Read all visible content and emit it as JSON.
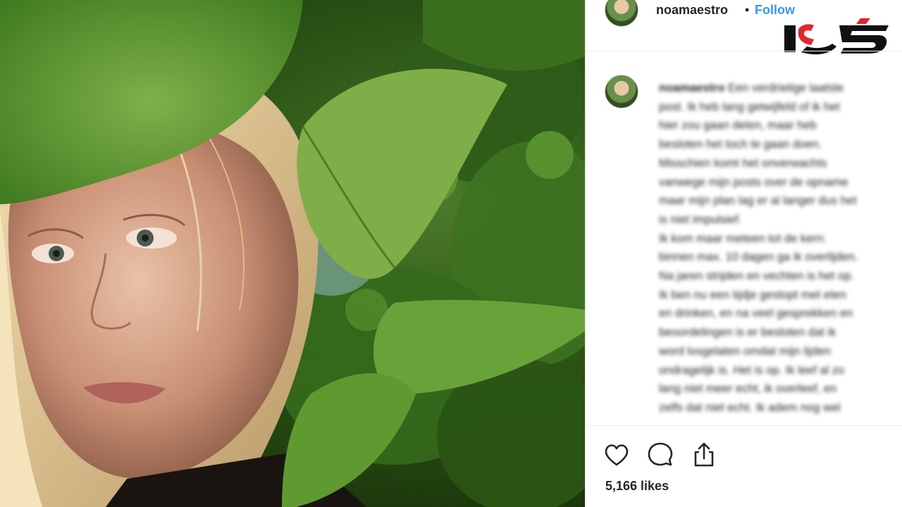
{
  "post": {
    "username": "noamaestro",
    "separator": "•",
    "follow_label": "Follow",
    "caption": {
      "username": "noamaestro",
      "lines": [
        " Een verdrietige laatste",
        "post. Ik heb lang getwijfeld of ik het",
        "hier zou gaan delen, maar heb",
        "besloten het toch te gaan doen.",
        "Misschien komt het onverwachts",
        "vanwege mijn posts over de opname",
        "maar mijn plan lag er al langer dus het",
        "is niet impulsief.",
        "Ik kom maar meteen tot de kern:",
        "binnen max. 10 dagen ga ik overlijden.",
        "Na jaren strijden en vechten is het op.",
        "Ik ben nu een tijdje gestopt met eten",
        "en drinken, en na veel gesprekken en",
        "beoordelingen is er besloten dat ik",
        "word losgelaten omdat mijn lijden",
        "ondragelijk is. Het is op. Ik leef al zo",
        "lang niet meer echt, ik overleef, en",
        "zelfs dat niet echt. Ik adem nog wel"
      ]
    },
    "likes_text": "5,166 likes",
    "icons": {
      "like": "heart-icon",
      "comment": "comment-icon",
      "share": "share-icon"
    }
  },
  "colors": {
    "follow_blue": "#3897f0",
    "text": "#262626",
    "logo_red": "#e3262b",
    "logo_black": "#111111"
  }
}
